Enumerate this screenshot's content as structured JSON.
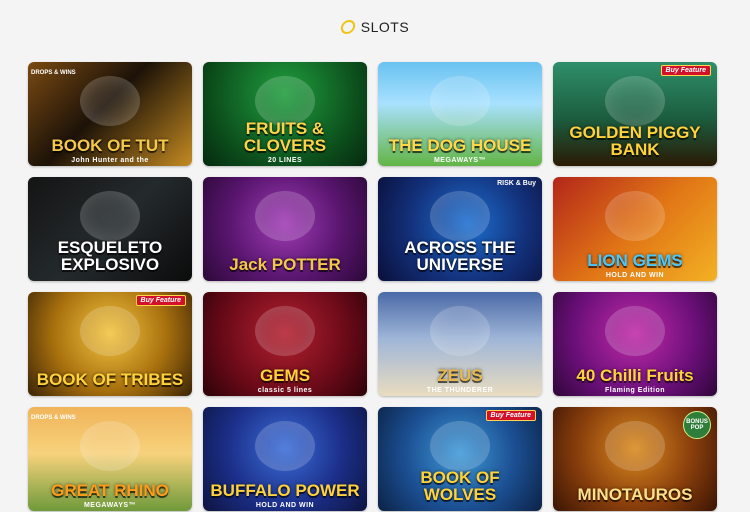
{
  "header": {
    "icon": "coin-icon",
    "title": "SLOTS",
    "accent": "#f2c318"
  },
  "games": [
    {
      "key": "book-of-tut",
      "title": "BOOK OF TUT",
      "sub": "John Hunter and the",
      "badge": "DROPS & WINS",
      "badge_type": "drops",
      "bg": "linear-gradient(135deg,#7a4a12 0%,#1c1208 45%,#c48a22 100%)",
      "color": "#f5c84a"
    },
    {
      "key": "fruits-clovers",
      "title": "FRUITS & CLOVERS",
      "sub": "20 LINES",
      "badge": "",
      "badge_type": "",
      "bg": "radial-gradient(circle at 50% 30%,#1f9e3e 0%,#0b4a1a 70%,#062a10 100%)",
      "color": "#ffd24a"
    },
    {
      "key": "dog-house",
      "title": "THE DOG HOUSE",
      "sub": "MEGAWAYS™",
      "badge": "",
      "badge_type": "",
      "bg": "linear-gradient(180deg,#69c2f0 0%,#a8e1ff 40%,#62b544 100%)",
      "color": "#ffd84a"
    },
    {
      "key": "golden-piggy",
      "title": "GOLDEN PIGGY BANK",
      "sub": "",
      "badge": "Buy Feature",
      "badge_type": "buy",
      "bg": "linear-gradient(180deg,#2f8f6a 0%,#1b5c3e 55%,#2a1a05 100%)",
      "color": "#ffd23a"
    },
    {
      "key": "esqueleto",
      "title": "ESQUELETO EXPLOSIVO",
      "sub": "",
      "badge": "",
      "badge_type": "",
      "bg": "linear-gradient(135deg,#141414 0%,#242a2c 50%,#0b0b0b 100%)",
      "color": "#ffffff"
    },
    {
      "key": "jack-potter",
      "title": "Jack POTTER",
      "sub": "",
      "badge": "",
      "badge_type": "",
      "bg": "radial-gradient(circle at 50% 45%,#a03bb5 0%,#5a1670 55%,#2c0838 100%)",
      "color": "#f2c74a"
    },
    {
      "key": "across-universe",
      "title": "ACROSS THE UNIVERSE",
      "sub": "",
      "badge": "RISK & Buy",
      "badge_type": "risk",
      "bg": "radial-gradient(circle at 55% 45%,#1d6fd0 0%,#13307a 55%,#0a0f3a 100%)",
      "color": "#ffffff"
    },
    {
      "key": "lion-gems",
      "title": "LION GEMS",
      "sub": "HOLD AND WIN",
      "badge": "",
      "badge_type": "",
      "bg": "linear-gradient(135deg,#b3261a 0%,#e07416 50%,#f3b123 100%)",
      "color": "#46c8ff"
    },
    {
      "key": "book-of-tribes",
      "title": "BOOK OF TRIBES",
      "sub": "",
      "badge": "Buy Feature",
      "badge_type": "buy",
      "bg": "radial-gradient(circle at 50% 40%,#f2c441 0%,#a8700d 55%,#3a2306 100%)",
      "color": "#ffd23a"
    },
    {
      "key": "777-gems",
      "title": "GEMS",
      "sub": "classic 5 lines",
      "badge": "",
      "badge_type": "",
      "bg": "radial-gradient(circle at 50% 40%,#b42030 0%,#6a0a18 60%,#2c0208 100%)",
      "color": "#ffd23a"
    },
    {
      "key": "zeus",
      "title": "ZEUS",
      "sub": "THE THUNDERER",
      "badge": "",
      "badge_type": "",
      "bg": "linear-gradient(180deg,#4b6aa8 0%,#9fb6d8 45%,#e9dcc0 100%)",
      "color": "#e8b84a"
    },
    {
      "key": "chilli-fruits",
      "title": "40 Chilli Fruits",
      "sub": "Flaming Edition",
      "badge": "",
      "badge_type": "",
      "bg": "radial-gradient(circle at 50% 40%,#c02aa8 0%,#6a0f78 60%,#2e0638 100%)",
      "color": "#ffd23a"
    },
    {
      "key": "great-rhino",
      "title": "GREAT RHINO",
      "sub": "MEGAWAYS™",
      "badge": "DROPS & WINS",
      "badge_type": "drops",
      "bg": "linear-gradient(180deg,#f0b45a 0%,#f7d27c 45%,#6f9a3a 100%)",
      "color": "#ff9a1a"
    },
    {
      "key": "buffalo-power",
      "title": "BUFFALO POWER",
      "sub": "HOLD AND WIN",
      "badge": "",
      "badge_type": "",
      "bg": "radial-gradient(circle at 50% 40%,#3b6ed8 0%,#1c2f8a 55%,#0d1440 100%)",
      "color": "#ffd23a"
    },
    {
      "key": "book-of-wolves",
      "title": "BOOK OF WOLVES",
      "sub": "",
      "badge": "Buy Feature",
      "badge_type": "buy",
      "bg": "radial-gradient(circle at 50% 45%,#3f9ad8 0%,#1b4f92 55%,#0c2246 100%)",
      "color": "#ffd23a"
    },
    {
      "key": "minotauros",
      "title": "MINOTAUROS",
      "sub": "",
      "badge": "BONUS POP",
      "badge_type": "bonus",
      "bg": "radial-gradient(circle at 50% 40%,#d98a1e 0%,#8a3f0c 55%,#3a1404 100%)",
      "color": "#ffe08a"
    }
  ]
}
